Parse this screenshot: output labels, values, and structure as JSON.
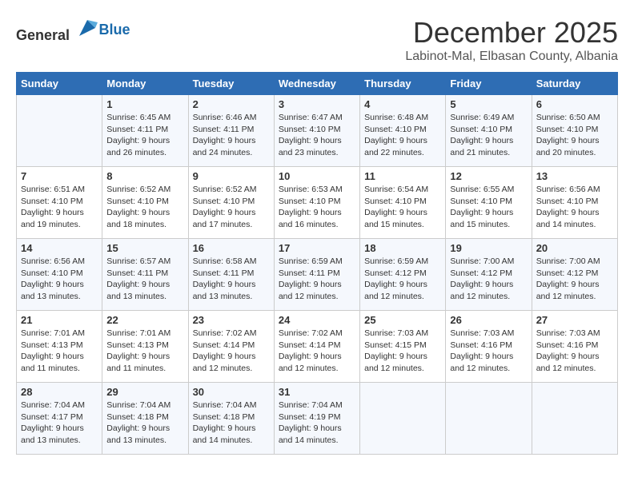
{
  "header": {
    "logo_general": "General",
    "logo_blue": "Blue",
    "month_year": "December 2025",
    "location": "Labinot-Mal, Elbasan County, Albania"
  },
  "days_of_week": [
    "Sunday",
    "Monday",
    "Tuesday",
    "Wednesday",
    "Thursday",
    "Friday",
    "Saturday"
  ],
  "weeks": [
    [
      {
        "day": "",
        "sunrise": "",
        "sunset": "",
        "daylight": ""
      },
      {
        "day": "1",
        "sunrise": "Sunrise: 6:45 AM",
        "sunset": "Sunset: 4:11 PM",
        "daylight": "Daylight: 9 hours and 26 minutes."
      },
      {
        "day": "2",
        "sunrise": "Sunrise: 6:46 AM",
        "sunset": "Sunset: 4:11 PM",
        "daylight": "Daylight: 9 hours and 24 minutes."
      },
      {
        "day": "3",
        "sunrise": "Sunrise: 6:47 AM",
        "sunset": "Sunset: 4:10 PM",
        "daylight": "Daylight: 9 hours and 23 minutes."
      },
      {
        "day": "4",
        "sunrise": "Sunrise: 6:48 AM",
        "sunset": "Sunset: 4:10 PM",
        "daylight": "Daylight: 9 hours and 22 minutes."
      },
      {
        "day": "5",
        "sunrise": "Sunrise: 6:49 AM",
        "sunset": "Sunset: 4:10 PM",
        "daylight": "Daylight: 9 hours and 21 minutes."
      },
      {
        "day": "6",
        "sunrise": "Sunrise: 6:50 AM",
        "sunset": "Sunset: 4:10 PM",
        "daylight": "Daylight: 9 hours and 20 minutes."
      }
    ],
    [
      {
        "day": "7",
        "sunrise": "Sunrise: 6:51 AM",
        "sunset": "Sunset: 4:10 PM",
        "daylight": "Daylight: 9 hours and 19 minutes."
      },
      {
        "day": "8",
        "sunrise": "Sunrise: 6:52 AM",
        "sunset": "Sunset: 4:10 PM",
        "daylight": "Daylight: 9 hours and 18 minutes."
      },
      {
        "day": "9",
        "sunrise": "Sunrise: 6:52 AM",
        "sunset": "Sunset: 4:10 PM",
        "daylight": "Daylight: 9 hours and 17 minutes."
      },
      {
        "day": "10",
        "sunrise": "Sunrise: 6:53 AM",
        "sunset": "Sunset: 4:10 PM",
        "daylight": "Daylight: 9 hours and 16 minutes."
      },
      {
        "day": "11",
        "sunrise": "Sunrise: 6:54 AM",
        "sunset": "Sunset: 4:10 PM",
        "daylight": "Daylight: 9 hours and 15 minutes."
      },
      {
        "day": "12",
        "sunrise": "Sunrise: 6:55 AM",
        "sunset": "Sunset: 4:10 PM",
        "daylight": "Daylight: 9 hours and 15 minutes."
      },
      {
        "day": "13",
        "sunrise": "Sunrise: 6:56 AM",
        "sunset": "Sunset: 4:10 PM",
        "daylight": "Daylight: 9 hours and 14 minutes."
      }
    ],
    [
      {
        "day": "14",
        "sunrise": "Sunrise: 6:56 AM",
        "sunset": "Sunset: 4:10 PM",
        "daylight": "Daylight: 9 hours and 13 minutes."
      },
      {
        "day": "15",
        "sunrise": "Sunrise: 6:57 AM",
        "sunset": "Sunset: 4:11 PM",
        "daylight": "Daylight: 9 hours and 13 minutes."
      },
      {
        "day": "16",
        "sunrise": "Sunrise: 6:58 AM",
        "sunset": "Sunset: 4:11 PM",
        "daylight": "Daylight: 9 hours and 13 minutes."
      },
      {
        "day": "17",
        "sunrise": "Sunrise: 6:59 AM",
        "sunset": "Sunset: 4:11 PM",
        "daylight": "Daylight: 9 hours and 12 minutes."
      },
      {
        "day": "18",
        "sunrise": "Sunrise: 6:59 AM",
        "sunset": "Sunset: 4:12 PM",
        "daylight": "Daylight: 9 hours and 12 minutes."
      },
      {
        "day": "19",
        "sunrise": "Sunrise: 7:00 AM",
        "sunset": "Sunset: 4:12 PM",
        "daylight": "Daylight: 9 hours and 12 minutes."
      },
      {
        "day": "20",
        "sunrise": "Sunrise: 7:00 AM",
        "sunset": "Sunset: 4:12 PM",
        "daylight": "Daylight: 9 hours and 12 minutes."
      }
    ],
    [
      {
        "day": "21",
        "sunrise": "Sunrise: 7:01 AM",
        "sunset": "Sunset: 4:13 PM",
        "daylight": "Daylight: 9 hours and 11 minutes."
      },
      {
        "day": "22",
        "sunrise": "Sunrise: 7:01 AM",
        "sunset": "Sunset: 4:13 PM",
        "daylight": "Daylight: 9 hours and 11 minutes."
      },
      {
        "day": "23",
        "sunrise": "Sunrise: 7:02 AM",
        "sunset": "Sunset: 4:14 PM",
        "daylight": "Daylight: 9 hours and 12 minutes."
      },
      {
        "day": "24",
        "sunrise": "Sunrise: 7:02 AM",
        "sunset": "Sunset: 4:14 PM",
        "daylight": "Daylight: 9 hours and 12 minutes."
      },
      {
        "day": "25",
        "sunrise": "Sunrise: 7:03 AM",
        "sunset": "Sunset: 4:15 PM",
        "daylight": "Daylight: 9 hours and 12 minutes."
      },
      {
        "day": "26",
        "sunrise": "Sunrise: 7:03 AM",
        "sunset": "Sunset: 4:16 PM",
        "daylight": "Daylight: 9 hours and 12 minutes."
      },
      {
        "day": "27",
        "sunrise": "Sunrise: 7:03 AM",
        "sunset": "Sunset: 4:16 PM",
        "daylight": "Daylight: 9 hours and 12 minutes."
      }
    ],
    [
      {
        "day": "28",
        "sunrise": "Sunrise: 7:04 AM",
        "sunset": "Sunset: 4:17 PM",
        "daylight": "Daylight: 9 hours and 13 minutes."
      },
      {
        "day": "29",
        "sunrise": "Sunrise: 7:04 AM",
        "sunset": "Sunset: 4:18 PM",
        "daylight": "Daylight: 9 hours and 13 minutes."
      },
      {
        "day": "30",
        "sunrise": "Sunrise: 7:04 AM",
        "sunset": "Sunset: 4:18 PM",
        "daylight": "Daylight: 9 hours and 14 minutes."
      },
      {
        "day": "31",
        "sunrise": "Sunrise: 7:04 AM",
        "sunset": "Sunset: 4:19 PM",
        "daylight": "Daylight: 9 hours and 14 minutes."
      },
      {
        "day": "",
        "sunrise": "",
        "sunset": "",
        "daylight": ""
      },
      {
        "day": "",
        "sunrise": "",
        "sunset": "",
        "daylight": ""
      },
      {
        "day": "",
        "sunrise": "",
        "sunset": "",
        "daylight": ""
      }
    ]
  ]
}
